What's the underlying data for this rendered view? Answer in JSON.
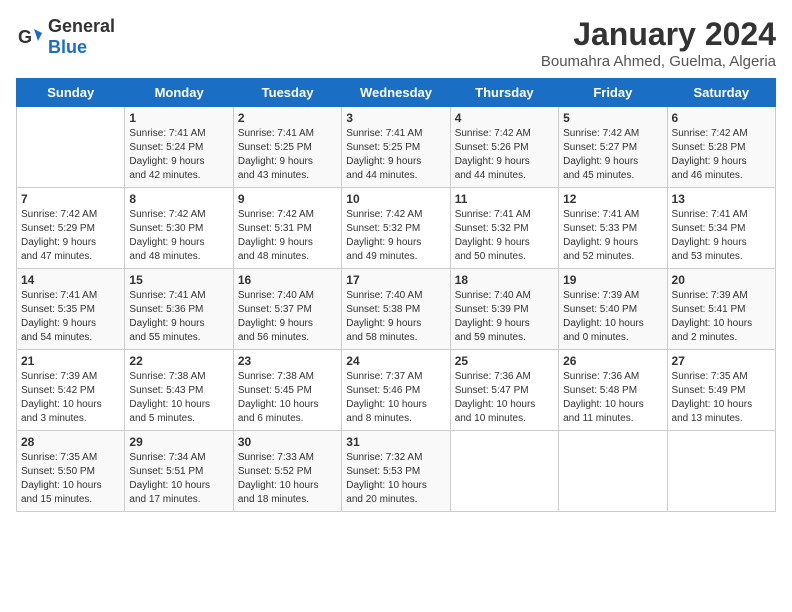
{
  "logo": {
    "text_general": "General",
    "text_blue": "Blue"
  },
  "title": "January 2024",
  "subtitle": "Boumahra Ahmed, Guelma, Algeria",
  "days_of_week": [
    "Sunday",
    "Monday",
    "Tuesday",
    "Wednesday",
    "Thursday",
    "Friday",
    "Saturday"
  ],
  "weeks": [
    [
      {
        "day": "",
        "info": ""
      },
      {
        "day": "1",
        "info": "Sunrise: 7:41 AM\nSunset: 5:24 PM\nDaylight: 9 hours\nand 42 minutes."
      },
      {
        "day": "2",
        "info": "Sunrise: 7:41 AM\nSunset: 5:25 PM\nDaylight: 9 hours\nand 43 minutes."
      },
      {
        "day": "3",
        "info": "Sunrise: 7:41 AM\nSunset: 5:25 PM\nDaylight: 9 hours\nand 44 minutes."
      },
      {
        "day": "4",
        "info": "Sunrise: 7:42 AM\nSunset: 5:26 PM\nDaylight: 9 hours\nand 44 minutes."
      },
      {
        "day": "5",
        "info": "Sunrise: 7:42 AM\nSunset: 5:27 PM\nDaylight: 9 hours\nand 45 minutes."
      },
      {
        "day": "6",
        "info": "Sunrise: 7:42 AM\nSunset: 5:28 PM\nDaylight: 9 hours\nand 46 minutes."
      }
    ],
    [
      {
        "day": "7",
        "info": "Sunrise: 7:42 AM\nSunset: 5:29 PM\nDaylight: 9 hours\nand 47 minutes."
      },
      {
        "day": "8",
        "info": "Sunrise: 7:42 AM\nSunset: 5:30 PM\nDaylight: 9 hours\nand 48 minutes."
      },
      {
        "day": "9",
        "info": "Sunrise: 7:42 AM\nSunset: 5:31 PM\nDaylight: 9 hours\nand 48 minutes."
      },
      {
        "day": "10",
        "info": "Sunrise: 7:42 AM\nSunset: 5:32 PM\nDaylight: 9 hours\nand 49 minutes."
      },
      {
        "day": "11",
        "info": "Sunrise: 7:41 AM\nSunset: 5:32 PM\nDaylight: 9 hours\nand 50 minutes."
      },
      {
        "day": "12",
        "info": "Sunrise: 7:41 AM\nSunset: 5:33 PM\nDaylight: 9 hours\nand 52 minutes."
      },
      {
        "day": "13",
        "info": "Sunrise: 7:41 AM\nSunset: 5:34 PM\nDaylight: 9 hours\nand 53 minutes."
      }
    ],
    [
      {
        "day": "14",
        "info": "Sunrise: 7:41 AM\nSunset: 5:35 PM\nDaylight: 9 hours\nand 54 minutes."
      },
      {
        "day": "15",
        "info": "Sunrise: 7:41 AM\nSunset: 5:36 PM\nDaylight: 9 hours\nand 55 minutes."
      },
      {
        "day": "16",
        "info": "Sunrise: 7:40 AM\nSunset: 5:37 PM\nDaylight: 9 hours\nand 56 minutes."
      },
      {
        "day": "17",
        "info": "Sunrise: 7:40 AM\nSunset: 5:38 PM\nDaylight: 9 hours\nand 58 minutes."
      },
      {
        "day": "18",
        "info": "Sunrise: 7:40 AM\nSunset: 5:39 PM\nDaylight: 9 hours\nand 59 minutes."
      },
      {
        "day": "19",
        "info": "Sunrise: 7:39 AM\nSunset: 5:40 PM\nDaylight: 10 hours\nand 0 minutes."
      },
      {
        "day": "20",
        "info": "Sunrise: 7:39 AM\nSunset: 5:41 PM\nDaylight: 10 hours\nand 2 minutes."
      }
    ],
    [
      {
        "day": "21",
        "info": "Sunrise: 7:39 AM\nSunset: 5:42 PM\nDaylight: 10 hours\nand 3 minutes."
      },
      {
        "day": "22",
        "info": "Sunrise: 7:38 AM\nSunset: 5:43 PM\nDaylight: 10 hours\nand 5 minutes."
      },
      {
        "day": "23",
        "info": "Sunrise: 7:38 AM\nSunset: 5:45 PM\nDaylight: 10 hours\nand 6 minutes."
      },
      {
        "day": "24",
        "info": "Sunrise: 7:37 AM\nSunset: 5:46 PM\nDaylight: 10 hours\nand 8 minutes."
      },
      {
        "day": "25",
        "info": "Sunrise: 7:36 AM\nSunset: 5:47 PM\nDaylight: 10 hours\nand 10 minutes."
      },
      {
        "day": "26",
        "info": "Sunrise: 7:36 AM\nSunset: 5:48 PM\nDaylight: 10 hours\nand 11 minutes."
      },
      {
        "day": "27",
        "info": "Sunrise: 7:35 AM\nSunset: 5:49 PM\nDaylight: 10 hours\nand 13 minutes."
      }
    ],
    [
      {
        "day": "28",
        "info": "Sunrise: 7:35 AM\nSunset: 5:50 PM\nDaylight: 10 hours\nand 15 minutes."
      },
      {
        "day": "29",
        "info": "Sunrise: 7:34 AM\nSunset: 5:51 PM\nDaylight: 10 hours\nand 17 minutes."
      },
      {
        "day": "30",
        "info": "Sunrise: 7:33 AM\nSunset: 5:52 PM\nDaylight: 10 hours\nand 18 minutes."
      },
      {
        "day": "31",
        "info": "Sunrise: 7:32 AM\nSunset: 5:53 PM\nDaylight: 10 hours\nand 20 minutes."
      },
      {
        "day": "",
        "info": ""
      },
      {
        "day": "",
        "info": ""
      },
      {
        "day": "",
        "info": ""
      }
    ]
  ]
}
